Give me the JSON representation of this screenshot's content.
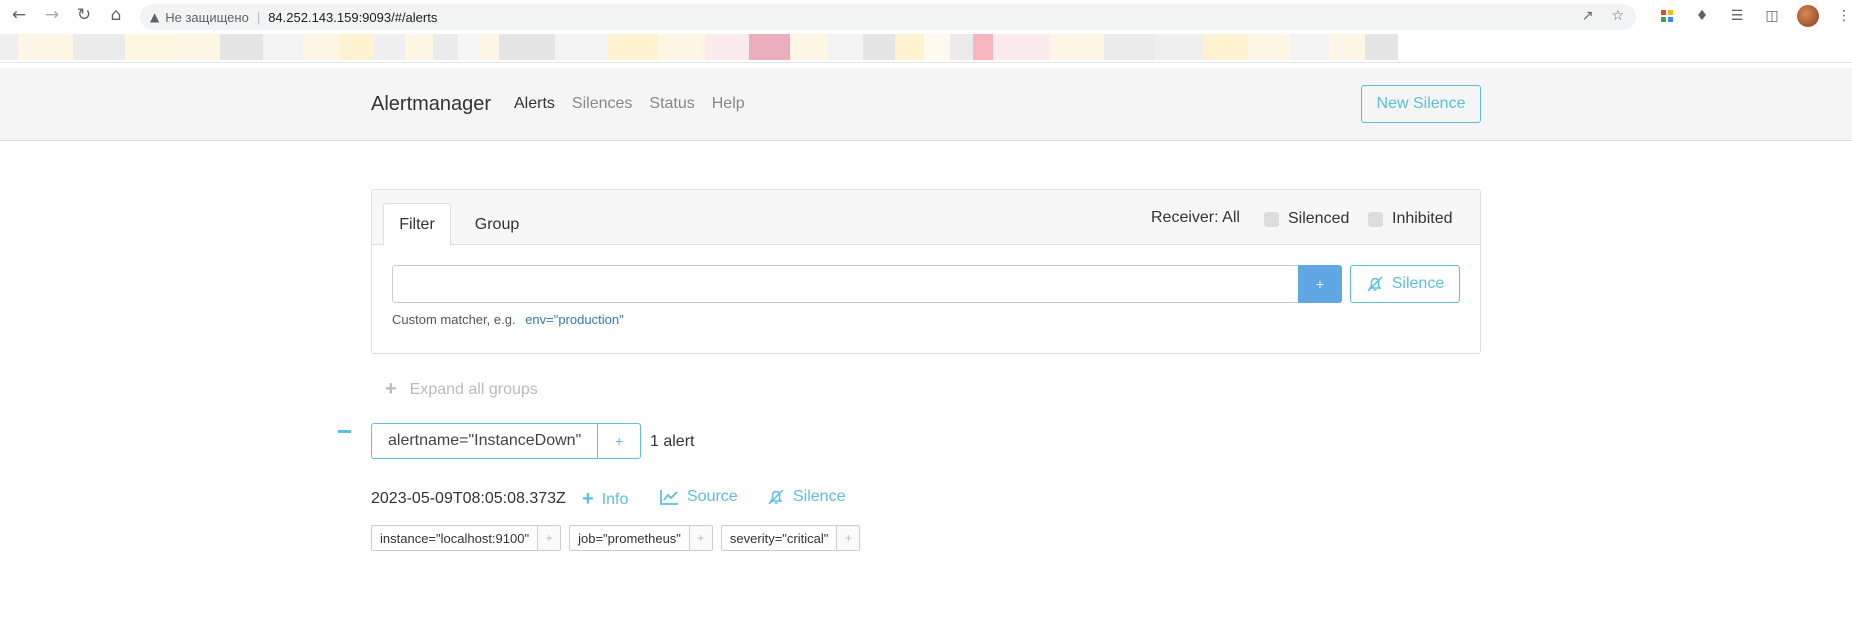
{
  "browser": {
    "omnibox": {
      "security_label": "Не защищено",
      "url": "84.252.143.159:9093/#/alerts"
    },
    "bookmark_colors": [
      "#fff5e0",
      "#e8e8e8",
      "#fff0c8",
      "#e0e0e0",
      "#f8d8dc",
      "#e8a0b0",
      "#fff3d0",
      "#eeeeee",
      "#f4a8b4"
    ]
  },
  "navbar": {
    "brand": "Alertmanager",
    "links": [
      {
        "label": "Alerts"
      },
      {
        "label": "Silences"
      },
      {
        "label": "Status"
      },
      {
        "label": "Help"
      }
    ],
    "new_silence_label": "New Silence"
  },
  "filter_card": {
    "tabs": [
      {
        "label": "Filter"
      },
      {
        "label": "Group"
      }
    ],
    "receiver_label": "Receiver: All",
    "silenced_label": "Silenced",
    "inhibited_label": "Inhibited",
    "filter_value": "",
    "add_button_label": "+",
    "silence_button_label": "Silence",
    "hint_text": "Custom matcher, e.g.",
    "hint_example": "env=\"production\""
  },
  "expand_all_label": "Expand all groups",
  "group": {
    "label": "alertname=\"InstanceDown\"",
    "plus_label": "+",
    "count_text": "1 alert",
    "alert": {
      "timestamp": "2023-05-09T08:05:08.373Z",
      "info_label": "Info",
      "source_label": "Source",
      "silence_label": "Silence",
      "labels": [
        {
          "text": "instance=\"localhost:9100\"",
          "plus": "+"
        },
        {
          "text": "job=\"prometheus\"",
          "plus": "+"
        },
        {
          "text": "severity=\"critical\"",
          "plus": "+"
        }
      ]
    }
  },
  "colors": {
    "accent": "#5bc0de",
    "primary": "#5fa8e3"
  }
}
